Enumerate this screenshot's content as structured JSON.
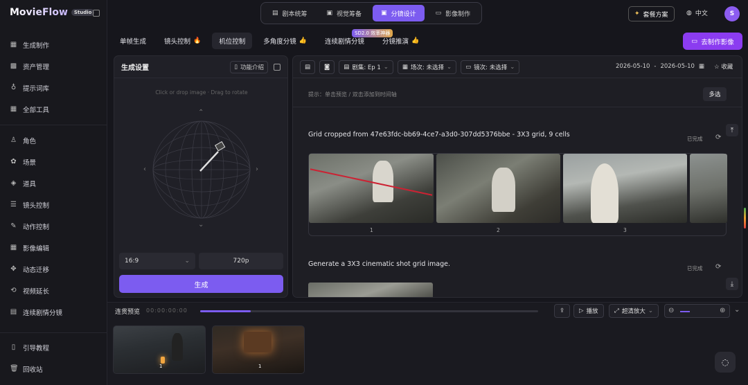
{
  "brand": {
    "name": "MovieFlow",
    "badge": "Studio"
  },
  "sidebar": {
    "group1": [
      {
        "label": "生成制作",
        "icon": "clapper-icon"
      },
      {
        "label": "资产管理",
        "icon": "grid-icon"
      },
      {
        "label": "提示词库",
        "icon": "bulb-icon"
      },
      {
        "label": "全部工具",
        "icon": "apps-icon"
      }
    ],
    "group2": [
      {
        "label": "角色",
        "icon": "user-icon"
      },
      {
        "label": "场景",
        "icon": "scene-icon"
      },
      {
        "label": "道具",
        "icon": "layers-icon"
      },
      {
        "label": "镜头控制",
        "icon": "sliders-icon"
      },
      {
        "label": "动作控制",
        "icon": "wand-icon"
      },
      {
        "label": "影像编辑",
        "icon": "film-icon"
      },
      {
        "label": "动态迁移",
        "icon": "move-icon"
      },
      {
        "label": "视频延长",
        "icon": "loop-icon"
      },
      {
        "label": "连续剧情分镜",
        "icon": "storyboard-icon"
      }
    ],
    "group3": [
      {
        "label": "引导教程",
        "icon": "book-icon"
      },
      {
        "label": "回收站",
        "icon": "trash-icon"
      }
    ]
  },
  "top_tabs": [
    {
      "label": "剧本统筹",
      "active": false
    },
    {
      "label": "视觉筹备",
      "active": false
    },
    {
      "label": "分镜设计",
      "active": true
    },
    {
      "label": "影像制作",
      "active": false
    }
  ],
  "header": {
    "plan": "套餐方案",
    "language": "中文",
    "avatar": "S"
  },
  "sub_tabs": [
    {
      "label": "单帧生成",
      "emoji": ""
    },
    {
      "label": "镜头控制",
      "emoji": "🔥"
    },
    {
      "label": "机位控制",
      "emoji": ""
    },
    {
      "label": "多角度分镜",
      "emoji": "👍"
    },
    {
      "label": "连续剧情分镜",
      "emoji": ""
    },
    {
      "label": "分镜推演",
      "emoji": "👍"
    }
  ],
  "sd_badge": "SD2.0 效率神器",
  "make_button": "去制作影像",
  "left_panel": {
    "title": "生成设置",
    "intro": "功能介绍",
    "drop_hint": "Click or drop image · Drag to rotate",
    "ratio": "16:9",
    "resolution": "720p",
    "generate": "生成"
  },
  "right_panel": {
    "episode": "剧集: Ep 1",
    "scene": "场次: 未选择",
    "shot": "镜次: 未选择",
    "date_from": "2026-05-10",
    "date_to": "2026-05-10",
    "fav": "收藏",
    "hint": "提示：单击预览 / 双击添加到时间轴",
    "multi": "多选",
    "card1": {
      "title": "Grid cropped from 47e63fdc-bb69-4ce7-a3d0-307dd5376bbe - 3X3 grid, 9 cells",
      "status": "已完成",
      "shots": [
        "1",
        "2",
        "3"
      ]
    },
    "card2": {
      "title": "Generate a 3X3 cinematic shot grid image.",
      "status": "已完成"
    }
  },
  "timeline": {
    "label": "连贯预览",
    "time": "00:00:00:00",
    "progress": 0.15,
    "play": "播放",
    "upscale": "超清放大",
    "clips": [
      {
        "num": "1"
      },
      {
        "num": "1"
      }
    ]
  }
}
